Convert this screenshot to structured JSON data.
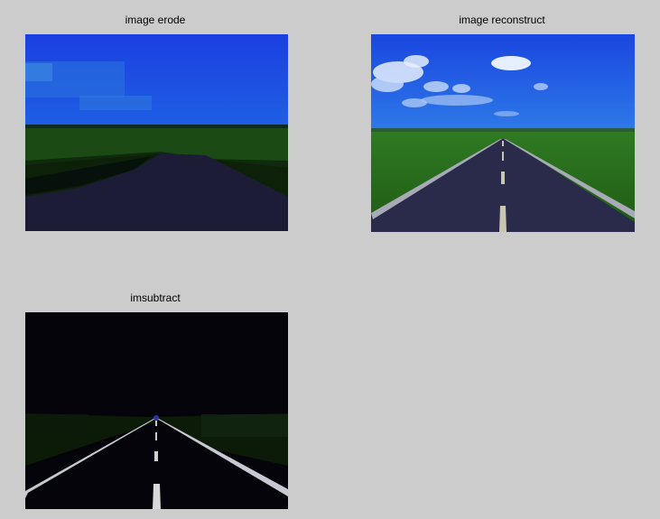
{
  "figure": {
    "panels": [
      {
        "title": "image erode"
      },
      {
        "title": "image reconstruct"
      },
      {
        "title": "imsubtract"
      }
    ]
  },
  "colors": {
    "background": "#cccccc",
    "sky_blue": "#1a4fd8",
    "grass_green": "#1e6a12",
    "road_dark": "#1f1f3a",
    "lane_marking": "#c8c8c8"
  }
}
